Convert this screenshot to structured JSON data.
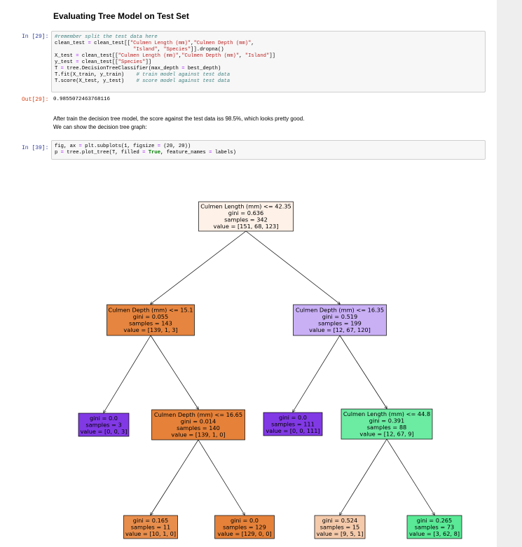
{
  "heading": "Evaluating Tree Model on Test Set",
  "cells": [
    {
      "prompt": "In [29]:",
      "code_lines": [
        "#remember split the test data here",
        "clean_test = clean_test[[\"Culmen Length (mm)\",\"Culmen Depth (mm)\",",
        "                          \"Island\", \"Species\"]].dropna()",
        "X_test = clean_test[[\"Culmen Length (mm)\",\"Culmen Depth (mm)\", \"Island\"]]",
        "y_test = clean_test[[\"Species\"]]",
        "T = tree.DecisionTreeClassifier(max_depth = best_depth)",
        "T.fit(X_train, y_train)    # train model against test data",
        "T.score(X_test, y_test)    # score model against test data"
      ]
    },
    {
      "prompt": "In [39]:",
      "code_lines": [
        "fig, ax = plt.subplots(1, figsize = (20, 20))",
        "p = tree.plot_tree(T, filled = True, feature_names = labels)"
      ]
    }
  ],
  "output": {
    "prompt": "Out[29]:",
    "text": "0.9855072463768116"
  },
  "markdown": {
    "line1": "After train the decision tree model, the score against the test data iss 98.5%, which looks pretty good.",
    "line2": "We can show the decision tree graph:"
  },
  "tree": {
    "nodes": [
      {
        "id": "root",
        "lines": [
          "Culmen Length (mm) <= 42.35",
          "gini = 0.636",
          "samples = 342",
          "value = [151, 68, 123]"
        ],
        "fill": "#fdf1e8"
      },
      {
        "id": "L",
        "lines": [
          "Culmen Depth (mm) <= 15.1",
          "gini = 0.055",
          "samples = 143",
          "value = [139, 1, 3]"
        ],
        "fill": "#e6853f"
      },
      {
        "id": "R",
        "lines": [
          "Culmen Depth (mm) <= 16.35",
          "gini = 0.519",
          "samples = 199",
          "value = [12, 67, 120]"
        ],
        "fill": "#c9b0f5"
      },
      {
        "id": "LL",
        "lines": [
          "gini = 0.0",
          "samples = 3",
          "value = [0, 0, 3]"
        ],
        "fill": "#8139e5"
      },
      {
        "id": "LR",
        "lines": [
          "Culmen Depth (mm) <= 16.65",
          "gini = 0.014",
          "samples = 140",
          "value = [139, 1, 0]"
        ],
        "fill": "#e58139"
      },
      {
        "id": "RL",
        "lines": [
          "gini = 0.0",
          "samples = 111",
          "value = [0, 0, 111]"
        ],
        "fill": "#8139e5"
      },
      {
        "id": "RR",
        "lines": [
          "Culmen Length (mm) <= 44.8",
          "gini = 0.391",
          "samples = 88",
          "value = [12, 67, 9]"
        ],
        "fill": "#6ceba2"
      },
      {
        "id": "LRL",
        "lines": [
          "gini = 0.165",
          "samples = 11",
          "value = [10, 1, 0]"
        ],
        "fill": "#e88e4d"
      },
      {
        "id": "LRR",
        "lines": [
          "gini = 0.0",
          "samples = 129",
          "value = [129, 0, 0]"
        ],
        "fill": "#e58139"
      },
      {
        "id": "RRL",
        "lines": [
          "gini = 0.524",
          "samples = 15",
          "value = [9, 5, 1]"
        ],
        "fill": "#f4caab"
      },
      {
        "id": "RRR",
        "lines": [
          "gini = 0.265",
          "samples = 73",
          "value = [3, 62, 8]"
        ],
        "fill": "#5ae996"
      }
    ]
  }
}
